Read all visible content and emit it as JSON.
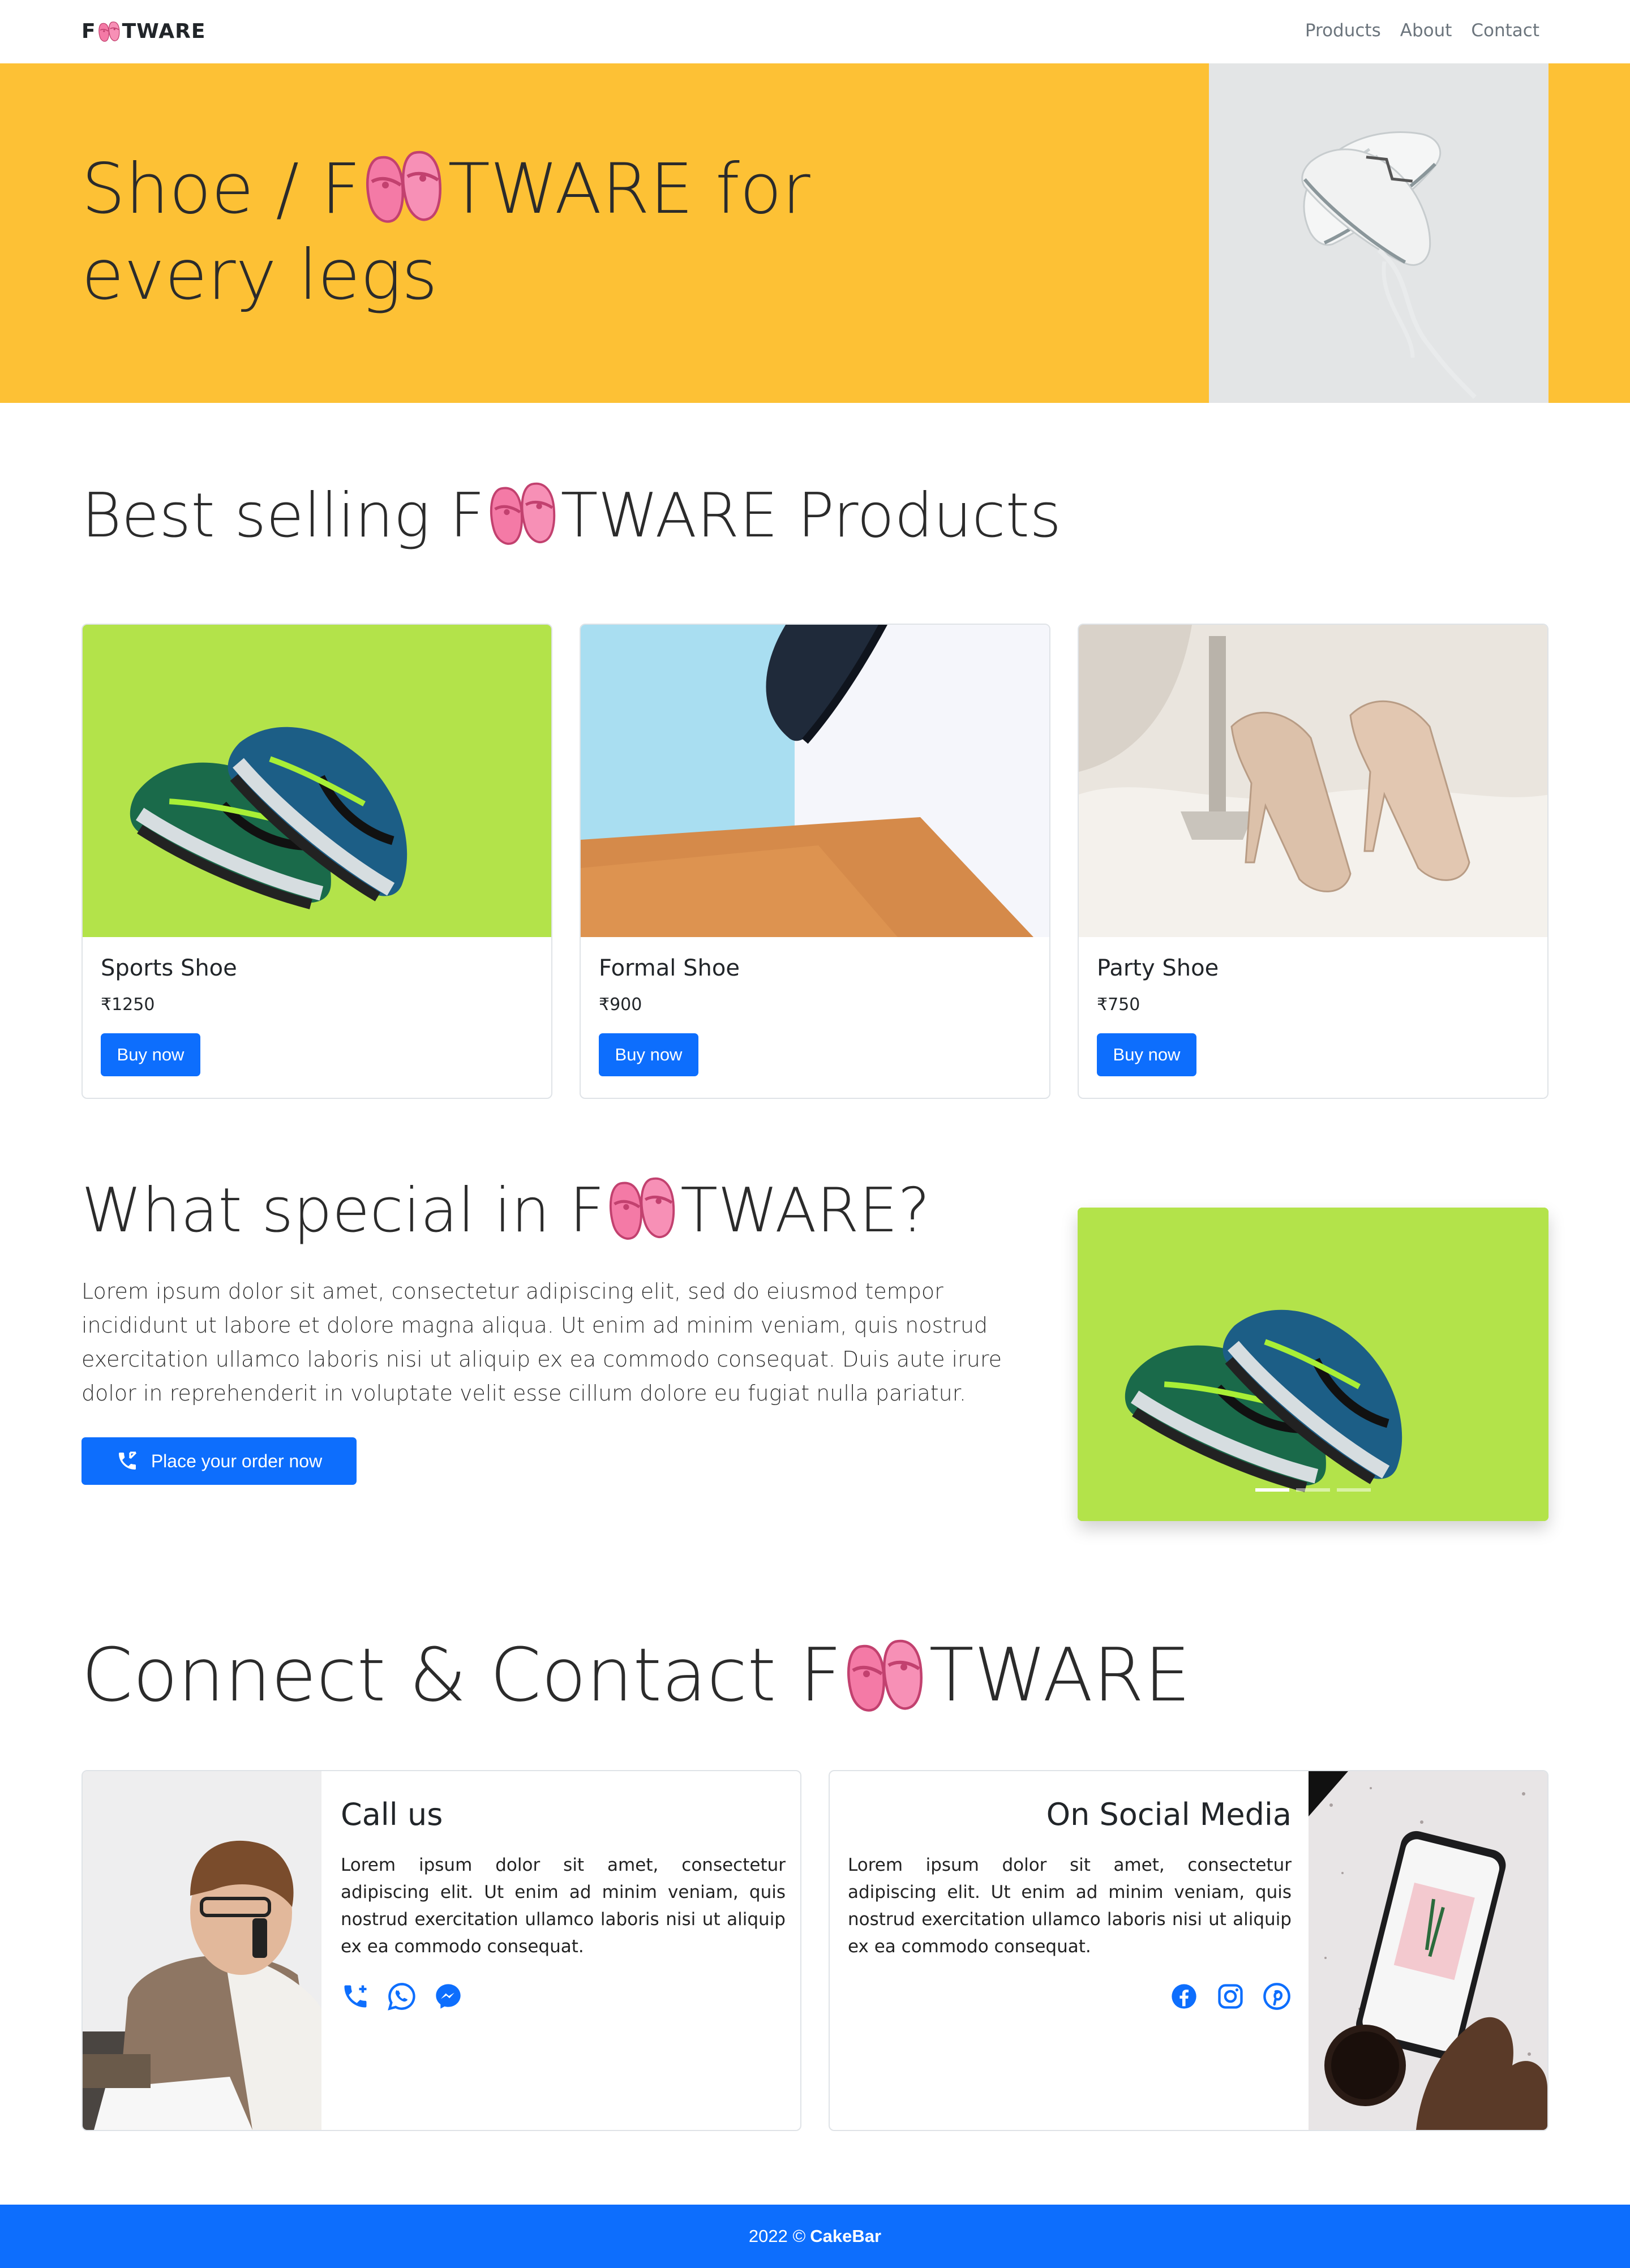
{
  "nav": {
    "brand_prefix": "F",
    "brand_suffix": "TWARE",
    "links": [
      "Products",
      "About",
      "Contact"
    ]
  },
  "hero": {
    "line1_prefix": "Shoe / F",
    "line1_suffix": "TWARE for",
    "line2": "every legs"
  },
  "best": {
    "title_prefix": "Best selling F",
    "title_suffix": "TWARE Products",
    "products": [
      {
        "name": "Sports Shoe",
        "price": "₹1250",
        "button": "Buy now"
      },
      {
        "name": "Formal Shoe",
        "price": "₹900",
        "button": "Buy now"
      },
      {
        "name": "Party Shoe",
        "price": "₹750",
        "button": "Buy now"
      }
    ]
  },
  "special": {
    "title_prefix": "What special in F",
    "title_suffix": "TWARE?",
    "body": "Lorem ipsum dolor sit amet, consectetur adipiscing elit, sed do eiusmod tempor incididunt ut labore et dolore magna aliqua. Ut enim ad minim veniam, quis nostrud exercitation ullamco laboris nisi ut aliquip ex ea commodo consequat. Duis aute irure dolor in reprehenderit in voluptate velit esse cillum dolore eu fugiat nulla pariatur.",
    "order_button": "Place your order now",
    "carousel_slides": 3,
    "active_slide": 1
  },
  "contact": {
    "title_prefix": "Connect & Contact F",
    "title_suffix": "TWARE",
    "call": {
      "heading": "Call us",
      "body": "Lorem ipsum dolor sit amet, consectetur adipiscing elit. Ut enim ad minim veniam, quis nostrud exercitation ullamco laboris nisi ut aliquip ex ea commodo consequat.",
      "icons": [
        "phone-icon",
        "whatsapp-icon",
        "messenger-icon"
      ]
    },
    "social": {
      "heading": "On Social Media",
      "body": "Lorem ipsum dolor sit amet, consectetur adipiscing elit. Ut enim ad minim veniam, quis nostrud exercitation ullamco laboris nisi ut aliquip ex ea commodo consequat.",
      "icons": [
        "facebook-icon",
        "instagram-icon",
        "pinterest-icon"
      ]
    }
  },
  "footer": {
    "year": "2022 ©",
    "brand": "CakeBar"
  },
  "colors": {
    "hero_bg": "#fdc135",
    "primary": "#0d6efd",
    "slipper": "#f47aa6"
  }
}
